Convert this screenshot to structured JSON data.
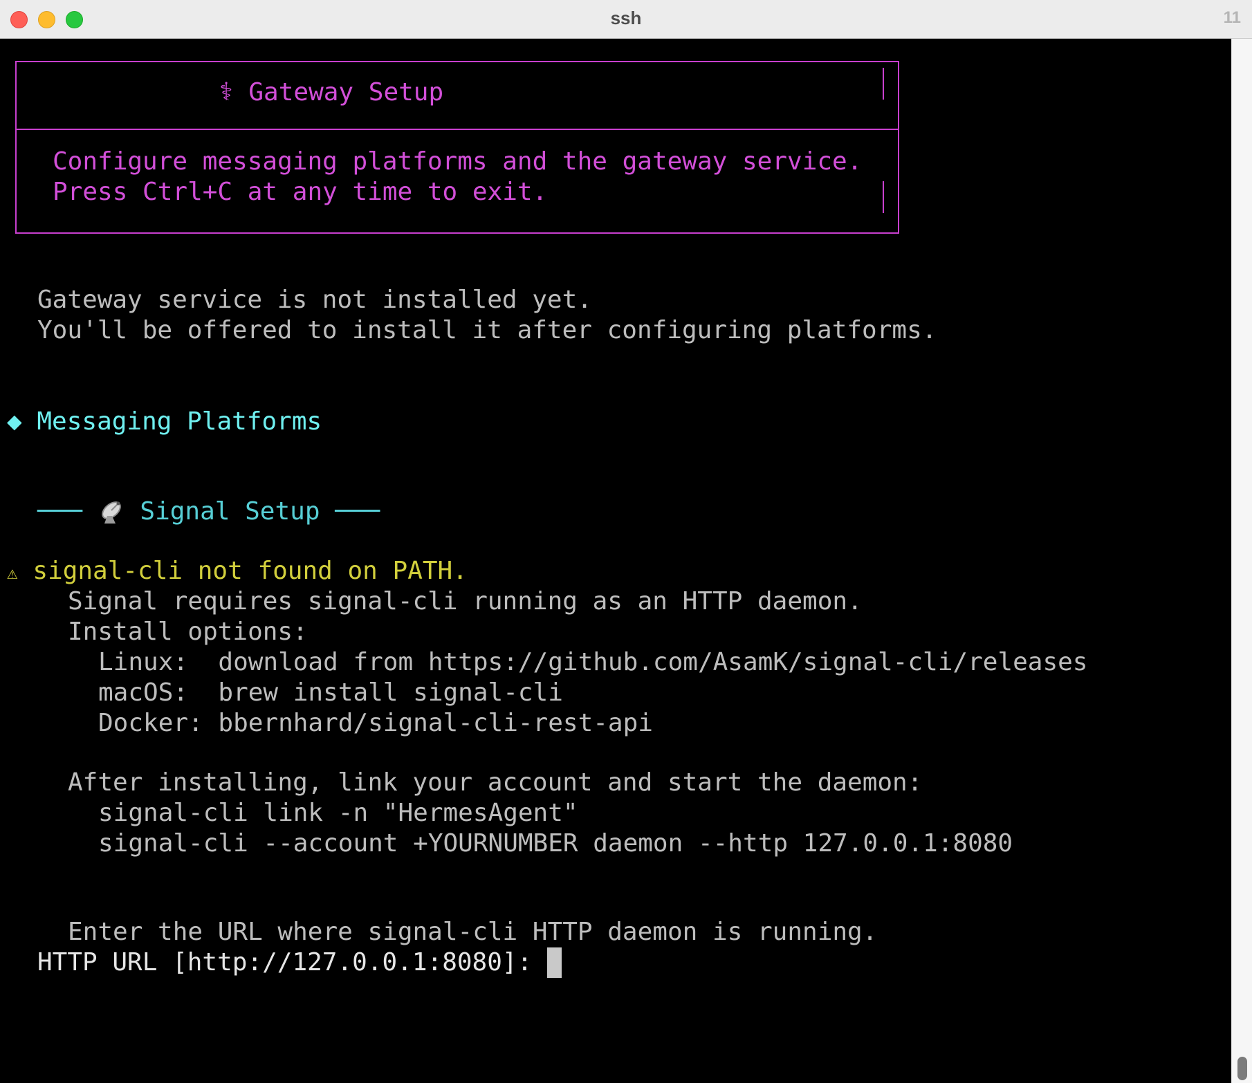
{
  "window": {
    "title": "ssh",
    "tab_count": "11"
  },
  "banner": {
    "title_icon": "⚕",
    "title": "Gateway Setup",
    "line1": "Configure messaging platforms and the gateway service.",
    "line2": "Press Ctrl+C at any time to exit."
  },
  "status": {
    "line1": "Gateway service is not installed yet.",
    "line2": "You'll be offered to install it after configuring platforms."
  },
  "section": {
    "icon": "◆",
    "title": "Messaging Platforms"
  },
  "signal": {
    "rule_left": "───",
    "icon": "satellite-dish-icon",
    "title": "Signal Setup",
    "rule_right": "───"
  },
  "warning": {
    "icon": "⚠",
    "text": "signal-cli not found on PATH.",
    "detail": "Signal requires signal-cli running as an HTTP daemon.",
    "options_header": "Install options:",
    "options": [
      "Linux:  download from https://github.com/AsamK/signal-cli/releases",
      "macOS:  brew install signal-cli",
      "Docker: bbernhard/signal-cli-rest-api"
    ],
    "after_header": "After installing, link your account and start the daemon:",
    "commands": [
      "signal-cli link -n \"HermesAgent\"",
      "signal-cli --account +YOURNUMBER daemon --http 127.0.0.1:8080"
    ]
  },
  "prompt": {
    "hint": "Enter the URL where signal-cli HTTP daemon is running.",
    "label": "HTTP URL [http://127.0.0.1:8080]: "
  },
  "colors": {
    "magenta": "#d24fd8",
    "cyan": "#6ff0f0",
    "yellow": "#d2cf3c",
    "text": "#bdbdbd"
  }
}
